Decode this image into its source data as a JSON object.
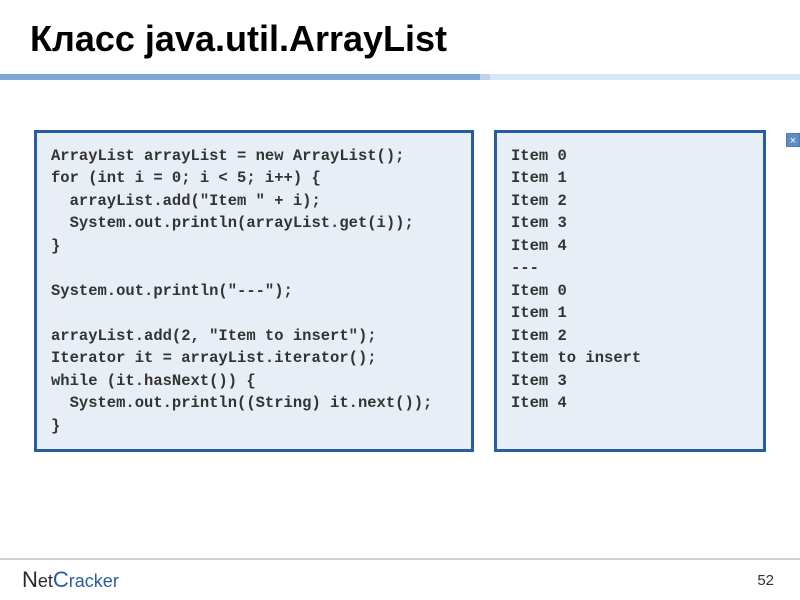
{
  "slide": {
    "title": "Класс java.util.ArrayList",
    "close_icon": "×",
    "code": "ArrayList arrayList = new ArrayList();\nfor (int i = 0; i < 5; i++) {\n  arrayList.add(\"Item \" + i);\n  System.out.println(arrayList.get(i));\n}\n\nSystem.out.println(\"---\");\n\narrayList.add(2, \"Item to insert\");\nIterator it = arrayList.iterator();\nwhile (it.hasNext()) {\n  System.out.println((String) it.next());\n}",
    "output": "Item 0\nItem 1\nItem 2\nItem 3\nItem 4\n---\nItem 0\nItem 1\nItem 2\nItem to insert\nItem 3\nItem 4"
  },
  "footer": {
    "logo_net": "Net",
    "logo_cracker": "Cracker",
    "page_number": "52"
  }
}
